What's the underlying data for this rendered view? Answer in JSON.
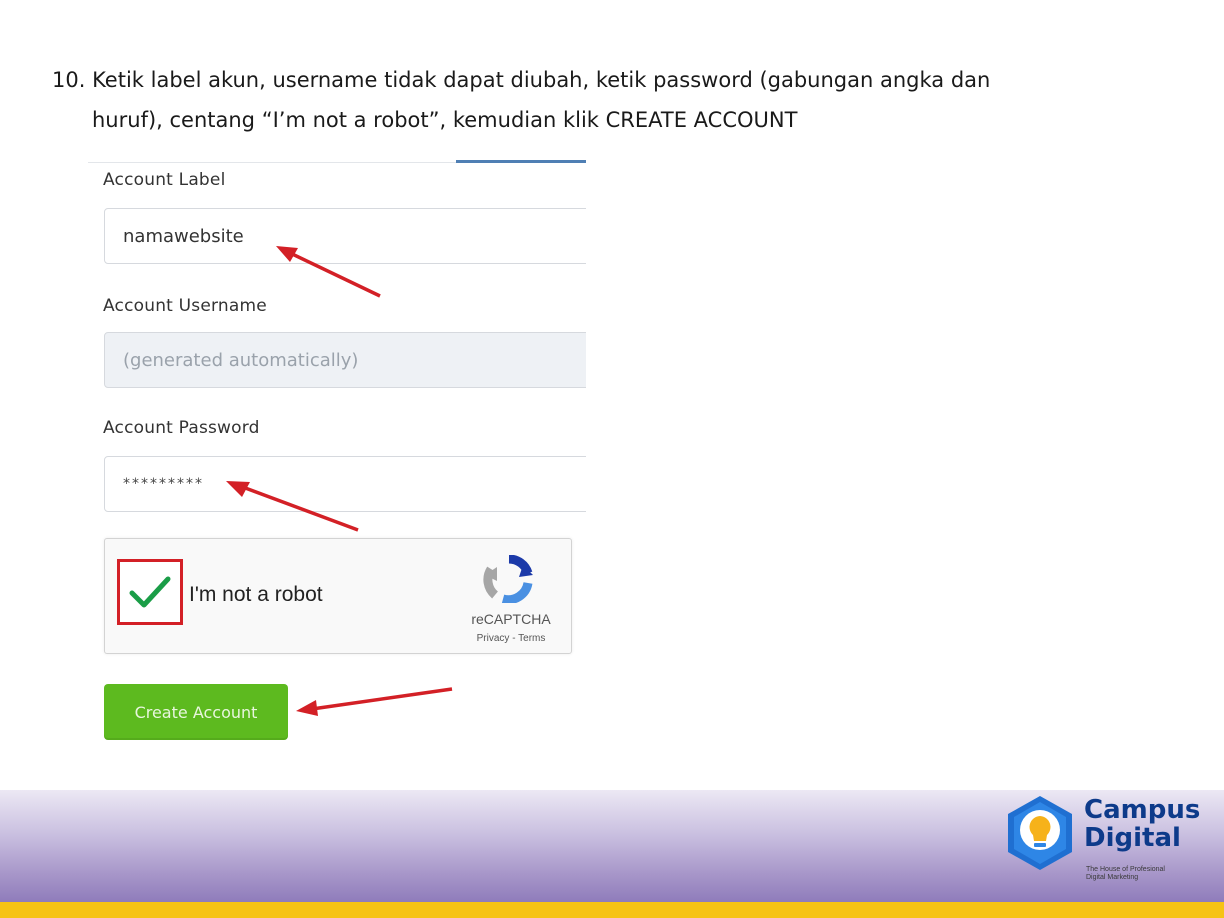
{
  "instruction": {
    "line1": "10. Ketik label akun, username tidak dapat diubah, ketik password (gabungan angka dan",
    "line2": "huruf), centang “I’m not a robot”, kemudian klik CREATE ACCOUNT"
  },
  "form": {
    "account_label": {
      "label": "Account Label",
      "value": "namawebsite"
    },
    "account_username": {
      "label": "Account Username",
      "placeholder": "(generated automatically)"
    },
    "account_password": {
      "label": "Account Password",
      "value": "*********"
    },
    "captcha": {
      "text": "I'm not a robot",
      "checked": true,
      "brand": "reCAPTCHA",
      "links": "Privacy - Terms"
    },
    "submit_label": "Create Account"
  },
  "logo": {
    "line1": "Campus",
    "line2": "Digital",
    "tagline1": "The House of Profesional",
    "tagline2": "Digital Marketing"
  },
  "colors": {
    "button_green": "#5dba1f",
    "arrow_red": "#d32026",
    "footer_purple": "#8f7cbb",
    "footer_yellow": "#f6c314",
    "logo_blue": "#0d3a8a"
  }
}
